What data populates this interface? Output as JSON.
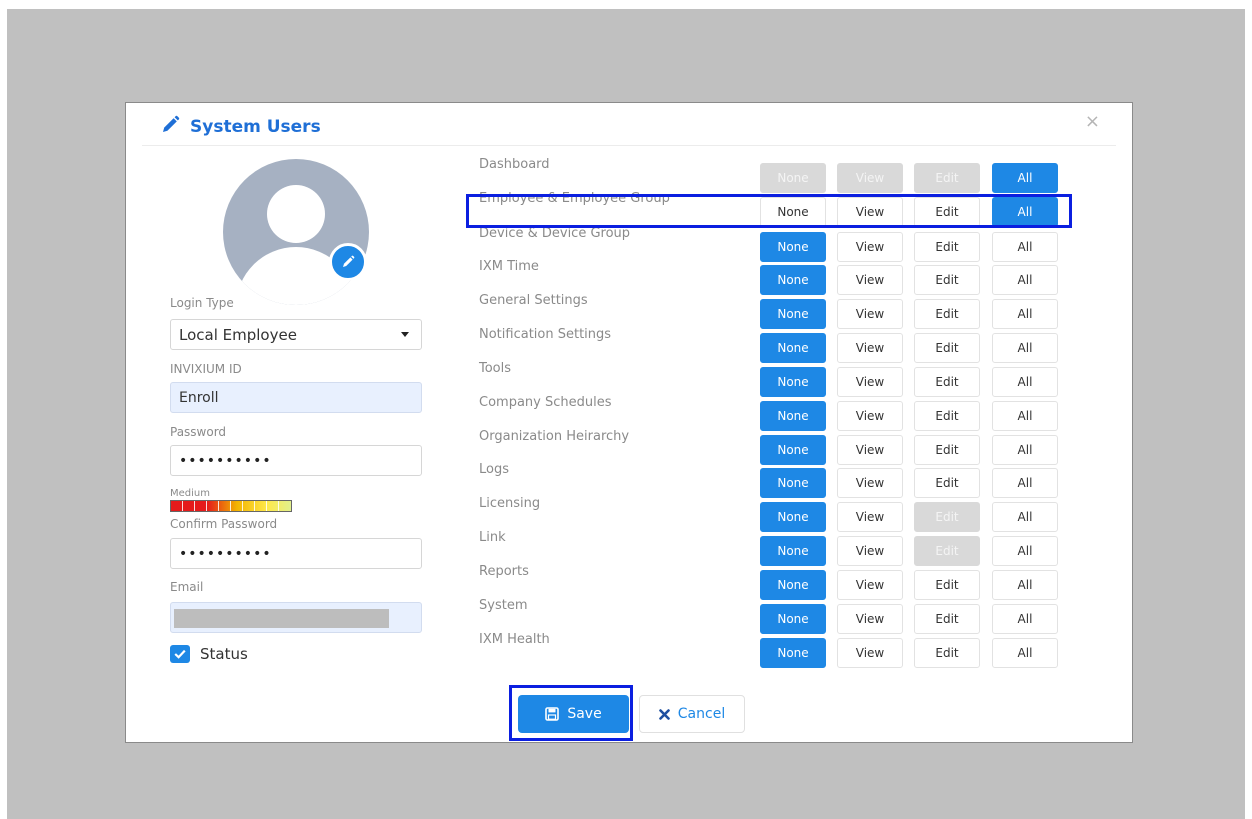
{
  "modal": {
    "title": "System Users",
    "title_icon": "pencil-icon",
    "close_icon": "close-icon",
    "close_glyph": "×"
  },
  "avatar": {
    "icon": "user-avatar-icon",
    "edit_icon": "pencil-icon"
  },
  "form": {
    "login_type_label": "Login Type",
    "login_type_value": "Local Employee",
    "invixium_id_label": "INVIXIUM ID",
    "invixium_id_value": "Enroll",
    "password_label": "Password",
    "password_value": "••••••••••",
    "strength_label": "Medium",
    "confirm_password_label": "Confirm Password",
    "confirm_password_value": "••••••••••",
    "email_label": "Email",
    "status_label": "Status",
    "status_checked": true
  },
  "permissions": {
    "button_labels": [
      "None",
      "View",
      "Edit",
      "All"
    ],
    "rows": [
      {
        "label": "Dashboard",
        "states": [
          "disabled",
          "disabled",
          "disabled",
          "active"
        ]
      },
      {
        "label": "Employee & Employee Group",
        "states": [
          "normal",
          "normal",
          "normal",
          "active"
        ]
      },
      {
        "label": "Device & Device Group",
        "states": [
          "active",
          "normal",
          "normal",
          "normal"
        ]
      },
      {
        "label": "IXM Time",
        "states": [
          "active",
          "normal",
          "normal",
          "normal"
        ]
      },
      {
        "label": "General Settings",
        "states": [
          "active",
          "normal",
          "normal",
          "normal"
        ]
      },
      {
        "label": "Notification Settings",
        "states": [
          "active",
          "normal",
          "normal",
          "normal"
        ]
      },
      {
        "label": "Tools",
        "states": [
          "active",
          "normal",
          "normal",
          "normal"
        ]
      },
      {
        "label": "Company Schedules",
        "states": [
          "active",
          "normal",
          "normal",
          "normal"
        ]
      },
      {
        "label": "Organization Heirarchy",
        "states": [
          "active",
          "normal",
          "normal",
          "normal"
        ]
      },
      {
        "label": "Logs",
        "states": [
          "active",
          "normal",
          "normal",
          "normal"
        ]
      },
      {
        "label": "Licensing",
        "states": [
          "active",
          "normal",
          "disabled",
          "normal"
        ]
      },
      {
        "label": "Link",
        "states": [
          "active",
          "normal",
          "disabled",
          "normal"
        ]
      },
      {
        "label": "Reports",
        "states": [
          "active",
          "normal",
          "normal",
          "normal"
        ]
      },
      {
        "label": "System",
        "states": [
          "active",
          "normal",
          "normal",
          "normal"
        ]
      },
      {
        "label": "IXM Health",
        "states": [
          "active",
          "normal",
          "normal",
          "normal"
        ]
      }
    ]
  },
  "actions": {
    "save_label": "Save",
    "save_icon": "floppy-disk-icon",
    "cancel_label": "Cancel",
    "cancel_icon": "x-icon"
  },
  "colors": {
    "accent": "#1e88e5",
    "highlight_box": "#0b1fe0",
    "backdrop": "#c0c0c0",
    "disabled": "#d9d9d9"
  }
}
